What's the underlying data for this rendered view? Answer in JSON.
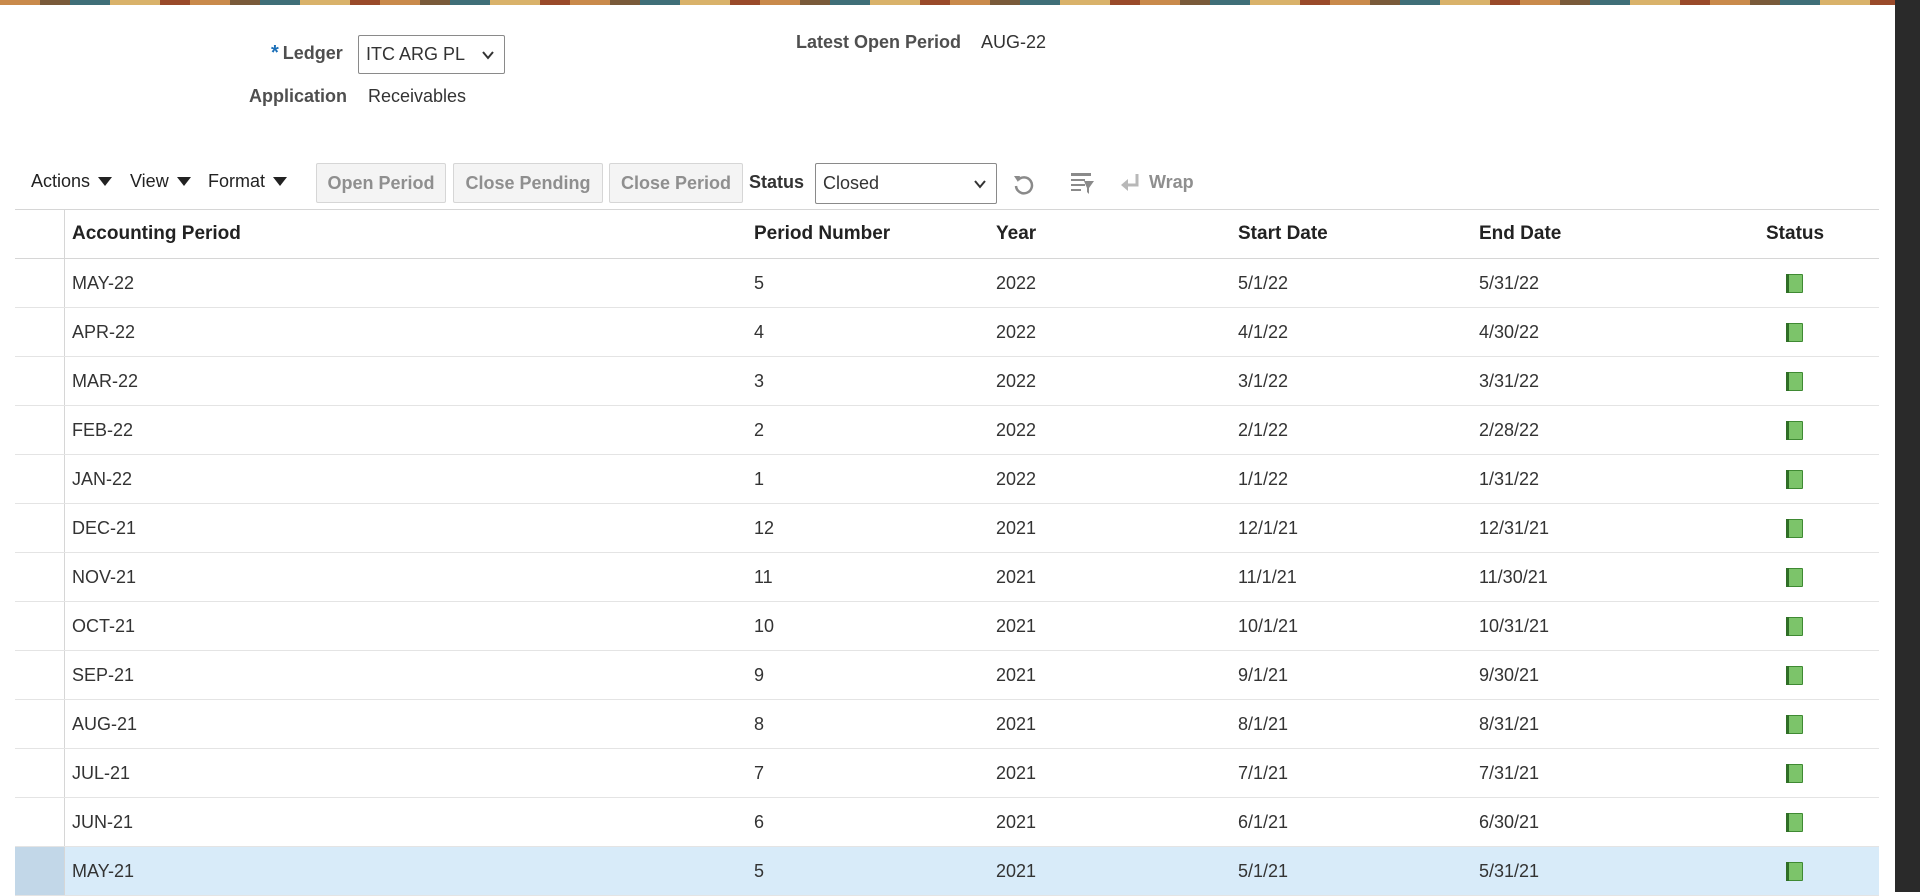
{
  "header": {
    "ledger_label": "Ledger",
    "ledger_value": "ITC ARG PL",
    "application_label": "Application",
    "application_value": "Receivables",
    "latest_open_label": "Latest Open Period",
    "latest_open_value": "AUG-22"
  },
  "toolbar": {
    "actions": "Actions",
    "view": "View",
    "format": "Format",
    "open_period": "Open Period",
    "close_pending": "Close Pending",
    "close_period": "Close Period",
    "status_label": "Status",
    "status_value": "Closed",
    "wrap": "Wrap"
  },
  "table": {
    "columns": [
      "Accounting Period",
      "Period Number",
      "Year",
      "Start Date",
      "End Date",
      "Status"
    ],
    "rows": [
      {
        "period": "MAY-22",
        "number": "5",
        "year": "2022",
        "start": "5/1/22",
        "end": "5/31/22"
      },
      {
        "period": "APR-22",
        "number": "4",
        "year": "2022",
        "start": "4/1/22",
        "end": "4/30/22"
      },
      {
        "period": "MAR-22",
        "number": "3",
        "year": "2022",
        "start": "3/1/22",
        "end": "3/31/22"
      },
      {
        "period": "FEB-22",
        "number": "2",
        "year": "2022",
        "start": "2/1/22",
        "end": "2/28/22"
      },
      {
        "period": "JAN-22",
        "number": "1",
        "year": "2022",
        "start": "1/1/22",
        "end": "1/31/22"
      },
      {
        "period": "DEC-21",
        "number": "12",
        "year": "2021",
        "start": "12/1/21",
        "end": "12/31/21"
      },
      {
        "period": "NOV-21",
        "number": "11",
        "year": "2021",
        "start": "11/1/21",
        "end": "11/30/21"
      },
      {
        "period": "OCT-21",
        "number": "10",
        "year": "2021",
        "start": "10/1/21",
        "end": "10/31/21"
      },
      {
        "period": "SEP-21",
        "number": "9",
        "year": "2021",
        "start": "9/1/21",
        "end": "9/30/21"
      },
      {
        "period": "AUG-21",
        "number": "8",
        "year": "2021",
        "start": "8/1/21",
        "end": "8/31/21"
      },
      {
        "period": "JUL-21",
        "number": "7",
        "year": "2021",
        "start": "7/1/21",
        "end": "7/31/21"
      },
      {
        "period": "JUN-21",
        "number": "6",
        "year": "2021",
        "start": "6/1/21",
        "end": "6/30/21"
      },
      {
        "period": "MAY-21",
        "number": "5",
        "year": "2021",
        "start": "5/1/21",
        "end": "5/31/21"
      }
    ],
    "selected_row_index": 12,
    "status_icon": "closed-book-icon"
  },
  "colors": {
    "accent": "#1b6fb8",
    "selected_row": "#d8ebf9",
    "status_icon_green": "#5aa84a"
  }
}
